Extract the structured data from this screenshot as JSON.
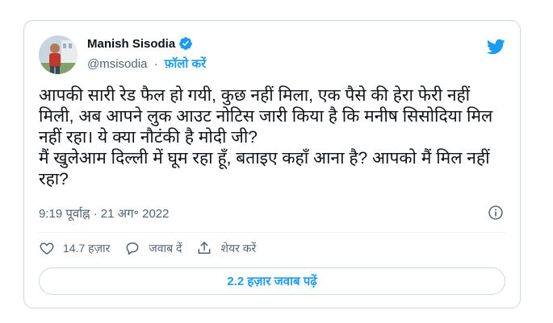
{
  "author": {
    "name": "Manish Sisodia",
    "handle": "@msisodia",
    "follow_label": "फ़ॉलो करें"
  },
  "tweet": {
    "text": "आपकी सारी रेड फैल हो गयी, कुछ नहीं मिला, एक पैसे की हेरा फेरी नहीं मिली, अब आपने लुक आउट नोटिस जारी किया है कि मनीष सिसोदिया मिल नहीं रहा। ये क्या नौटंकी है मोदी जी?\nमैं खुलेआम दिल्ली में घूम रहा हूँ, बताइए कहाँ आना है? आपको मैं मिल नहीं रहा?",
    "time": "9:19 पूर्वाह्न",
    "date": "21 अग॰ 2022"
  },
  "actions": {
    "likes": "14.7 हज़ार",
    "reply_label": "जवाब दें",
    "share_label": "शेयर करें"
  },
  "replies_button": "2.2 हज़ार जवाब पढ़ें",
  "colors": {
    "accent": "#1d9bf0",
    "text": "#0f1419",
    "secondary": "#536471",
    "border": "#cfd9de"
  },
  "icons": [
    "verified-icon",
    "twitter-logo-icon",
    "info-icon",
    "heart-icon",
    "reply-icon",
    "share-icon"
  ]
}
